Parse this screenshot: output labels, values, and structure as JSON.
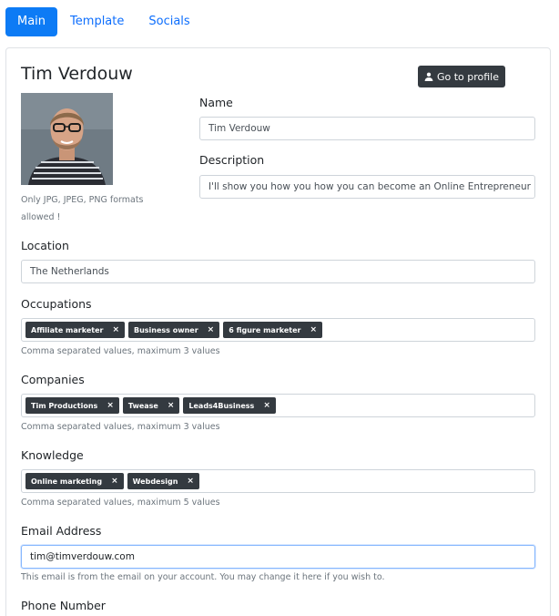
{
  "tabs": [
    {
      "label": "Main",
      "active": true
    },
    {
      "label": "Template",
      "active": false
    },
    {
      "label": "Socials",
      "active": false
    }
  ],
  "profile": {
    "name": "Tim Verdouw",
    "goto_label": "Go to profile",
    "photo_note": "Only JPG, JPEG, PNG formats allowed !"
  },
  "fields": {
    "name": {
      "label": "Name",
      "value": "Tim Verdouw"
    },
    "description": {
      "label": "Description",
      "value": "I'll show you how you  how you can become an Online Entrepreneur"
    },
    "location": {
      "label": "Location",
      "value": "The Netherlands"
    },
    "occupations": {
      "label": "Occupations",
      "tags": [
        "Affiliate marketer",
        "Business owner",
        "6 figure marketer"
      ],
      "help": "Comma separated values, maximum 3 values"
    },
    "companies": {
      "label": "Companies",
      "tags": [
        "Tim Productions",
        "Twease",
        "Leads4Business"
      ],
      "help": "Comma separated values, maximum 3 values"
    },
    "knowledge": {
      "label": "Knowledge",
      "tags": [
        "Online marketing",
        "Webdesign"
      ],
      "help": "Comma separated values, maximum 5 values"
    },
    "email": {
      "label": "Email Address",
      "value": "tim@timverdouw.com",
      "help": "This email is from the email on your account. You may change it here if you wish to."
    },
    "phone": {
      "label": "Phone Number"
    }
  },
  "icons": {
    "goto": "user-icon",
    "tag_remove": "×"
  }
}
